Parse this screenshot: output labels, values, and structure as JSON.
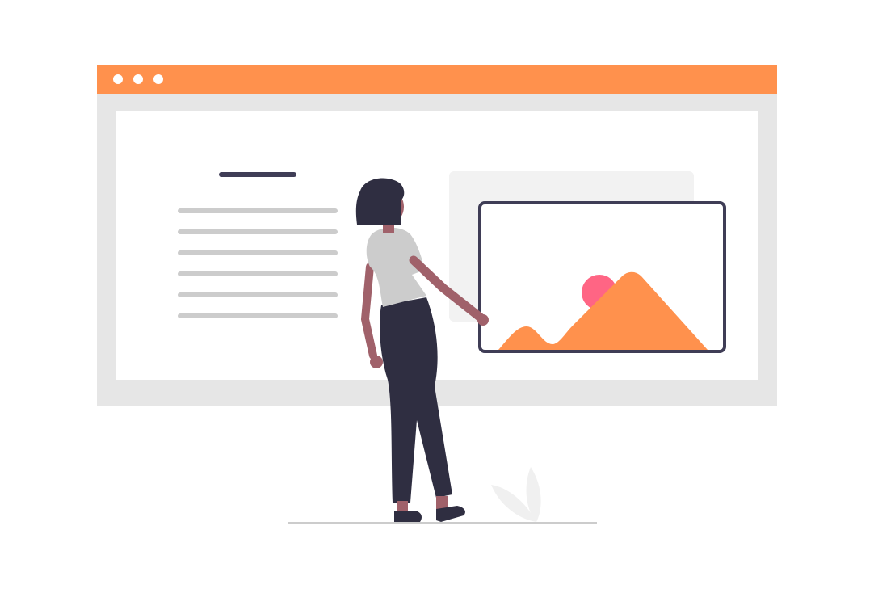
{
  "illustration": {
    "description_free": true,
    "window_controls": [
      "dot-1",
      "dot-2",
      "dot-3"
    ]
  },
  "colors": {
    "accent": "#ff914d",
    "frame": "#e6e6e6",
    "card": "#f2f2f2",
    "text_line": "#cccccc",
    "heading_line": "#3f3d56",
    "sun": "#ff6584",
    "hair_pants": "#2f2e41",
    "skin": "#a0616a",
    "shirt": "#cccccc",
    "ground": "#cccccc"
  },
  "icons": {
    "image_frame": "image-icon",
    "mountains": "mountain-icon",
    "sun": "sun-icon"
  }
}
